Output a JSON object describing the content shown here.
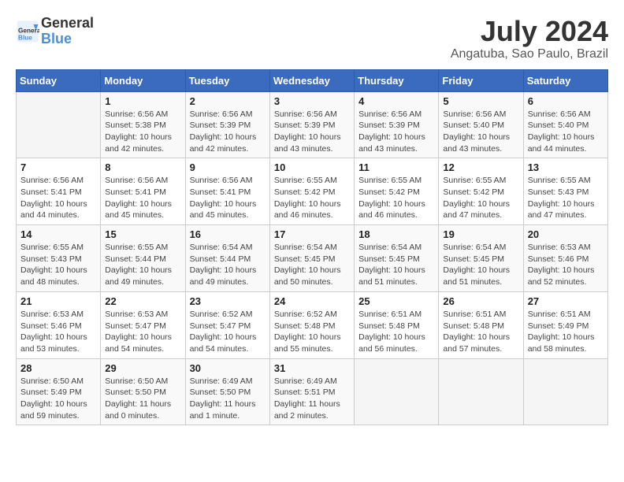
{
  "header": {
    "logo_line1": "General",
    "logo_line2": "Blue",
    "month_year": "July 2024",
    "location": "Angatuba, Sao Paulo, Brazil"
  },
  "days_of_week": [
    "Sunday",
    "Monday",
    "Tuesday",
    "Wednesday",
    "Thursday",
    "Friday",
    "Saturday"
  ],
  "weeks": [
    [
      {
        "day": "",
        "info": ""
      },
      {
        "day": "1",
        "info": "Sunrise: 6:56 AM\nSunset: 5:38 PM\nDaylight: 10 hours\nand 42 minutes."
      },
      {
        "day": "2",
        "info": "Sunrise: 6:56 AM\nSunset: 5:39 PM\nDaylight: 10 hours\nand 42 minutes."
      },
      {
        "day": "3",
        "info": "Sunrise: 6:56 AM\nSunset: 5:39 PM\nDaylight: 10 hours\nand 43 minutes."
      },
      {
        "day": "4",
        "info": "Sunrise: 6:56 AM\nSunset: 5:39 PM\nDaylight: 10 hours\nand 43 minutes."
      },
      {
        "day": "5",
        "info": "Sunrise: 6:56 AM\nSunset: 5:40 PM\nDaylight: 10 hours\nand 43 minutes."
      },
      {
        "day": "6",
        "info": "Sunrise: 6:56 AM\nSunset: 5:40 PM\nDaylight: 10 hours\nand 44 minutes."
      }
    ],
    [
      {
        "day": "7",
        "info": "Sunrise: 6:56 AM\nSunset: 5:41 PM\nDaylight: 10 hours\nand 44 minutes."
      },
      {
        "day": "8",
        "info": "Sunrise: 6:56 AM\nSunset: 5:41 PM\nDaylight: 10 hours\nand 45 minutes."
      },
      {
        "day": "9",
        "info": "Sunrise: 6:56 AM\nSunset: 5:41 PM\nDaylight: 10 hours\nand 45 minutes."
      },
      {
        "day": "10",
        "info": "Sunrise: 6:55 AM\nSunset: 5:42 PM\nDaylight: 10 hours\nand 46 minutes."
      },
      {
        "day": "11",
        "info": "Sunrise: 6:55 AM\nSunset: 5:42 PM\nDaylight: 10 hours\nand 46 minutes."
      },
      {
        "day": "12",
        "info": "Sunrise: 6:55 AM\nSunset: 5:42 PM\nDaylight: 10 hours\nand 47 minutes."
      },
      {
        "day": "13",
        "info": "Sunrise: 6:55 AM\nSunset: 5:43 PM\nDaylight: 10 hours\nand 47 minutes."
      }
    ],
    [
      {
        "day": "14",
        "info": "Sunrise: 6:55 AM\nSunset: 5:43 PM\nDaylight: 10 hours\nand 48 minutes."
      },
      {
        "day": "15",
        "info": "Sunrise: 6:55 AM\nSunset: 5:44 PM\nDaylight: 10 hours\nand 49 minutes."
      },
      {
        "day": "16",
        "info": "Sunrise: 6:54 AM\nSunset: 5:44 PM\nDaylight: 10 hours\nand 49 minutes."
      },
      {
        "day": "17",
        "info": "Sunrise: 6:54 AM\nSunset: 5:45 PM\nDaylight: 10 hours\nand 50 minutes."
      },
      {
        "day": "18",
        "info": "Sunrise: 6:54 AM\nSunset: 5:45 PM\nDaylight: 10 hours\nand 51 minutes."
      },
      {
        "day": "19",
        "info": "Sunrise: 6:54 AM\nSunset: 5:45 PM\nDaylight: 10 hours\nand 51 minutes."
      },
      {
        "day": "20",
        "info": "Sunrise: 6:53 AM\nSunset: 5:46 PM\nDaylight: 10 hours\nand 52 minutes."
      }
    ],
    [
      {
        "day": "21",
        "info": "Sunrise: 6:53 AM\nSunset: 5:46 PM\nDaylight: 10 hours\nand 53 minutes."
      },
      {
        "day": "22",
        "info": "Sunrise: 6:53 AM\nSunset: 5:47 PM\nDaylight: 10 hours\nand 54 minutes."
      },
      {
        "day": "23",
        "info": "Sunrise: 6:52 AM\nSunset: 5:47 PM\nDaylight: 10 hours\nand 54 minutes."
      },
      {
        "day": "24",
        "info": "Sunrise: 6:52 AM\nSunset: 5:48 PM\nDaylight: 10 hours\nand 55 minutes."
      },
      {
        "day": "25",
        "info": "Sunrise: 6:51 AM\nSunset: 5:48 PM\nDaylight: 10 hours\nand 56 minutes."
      },
      {
        "day": "26",
        "info": "Sunrise: 6:51 AM\nSunset: 5:48 PM\nDaylight: 10 hours\nand 57 minutes."
      },
      {
        "day": "27",
        "info": "Sunrise: 6:51 AM\nSunset: 5:49 PM\nDaylight: 10 hours\nand 58 minutes."
      }
    ],
    [
      {
        "day": "28",
        "info": "Sunrise: 6:50 AM\nSunset: 5:49 PM\nDaylight: 10 hours\nand 59 minutes."
      },
      {
        "day": "29",
        "info": "Sunrise: 6:50 AM\nSunset: 5:50 PM\nDaylight: 11 hours\nand 0 minutes."
      },
      {
        "day": "30",
        "info": "Sunrise: 6:49 AM\nSunset: 5:50 PM\nDaylight: 11 hours\nand 1 minute."
      },
      {
        "day": "31",
        "info": "Sunrise: 6:49 AM\nSunset: 5:51 PM\nDaylight: 11 hours\nand 2 minutes."
      },
      {
        "day": "",
        "info": ""
      },
      {
        "day": "",
        "info": ""
      },
      {
        "day": "",
        "info": ""
      }
    ]
  ]
}
